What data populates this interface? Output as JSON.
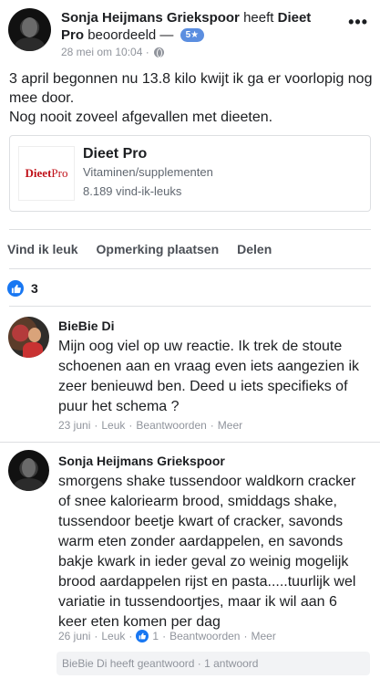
{
  "post": {
    "author": "Sonja Heijmans Griekspoor",
    "action": "heeft",
    "page": "Dieet Pro",
    "verb": "beoordeeld —",
    "rating_badge": "5★",
    "timestamp": "28 mei om 10:04 ·",
    "more": "•••",
    "text": "3 april begonnen nu 13.8 kilo kwijt ik ga er voorlopig nog mee door.\nNog nooit zoveel afgevallen met dieeten."
  },
  "page_card": {
    "logo_text_bold": "Dieet",
    "logo_text": "Pro",
    "name": "Dieet Pro",
    "category": "Vitaminen/supplementen",
    "likes": "8.189 vind-ik-leuks"
  },
  "actions": {
    "like": "Vind ik leuk",
    "comment": "Opmerking plaatsen",
    "share": "Delen"
  },
  "reactions": {
    "count": "3"
  },
  "comments": [
    {
      "name": "BieBie Di",
      "text": "Mijn oog viel op uw reactie. Ik trek de stoute schoenen aan en vraag even iets aangezien ik zeer benieuwd ben. Deed u iets specifieks of puur het schema ?",
      "date": "23 juni",
      "like": "Leuk",
      "reply": "Beantwoorden",
      "more": "Meer"
    },
    {
      "name": "Sonja Heijmans Griekspoor",
      "text": "smorgens shake tussendoor waldkorn cracker of snee kaloriearm brood, smiddags shake, tussendoor beetje kwart of cracker, savonds warm eten zonder aardappelen, en savonds bakje kwark in ieder geval zo weinig mogelijk brood aardappelen rijst en pasta.....tuurlijk wel variatie in tussendoortjes, maar ik wil aan 6 keer eten komen per dag",
      "date": "26 juni",
      "like": "Leuk",
      "like_count": "1",
      "reply": "Beantwoorden",
      "more": "Meer"
    }
  ],
  "reply_summary": "BieBie Di heeft geantwoord · 1 antwoord"
}
